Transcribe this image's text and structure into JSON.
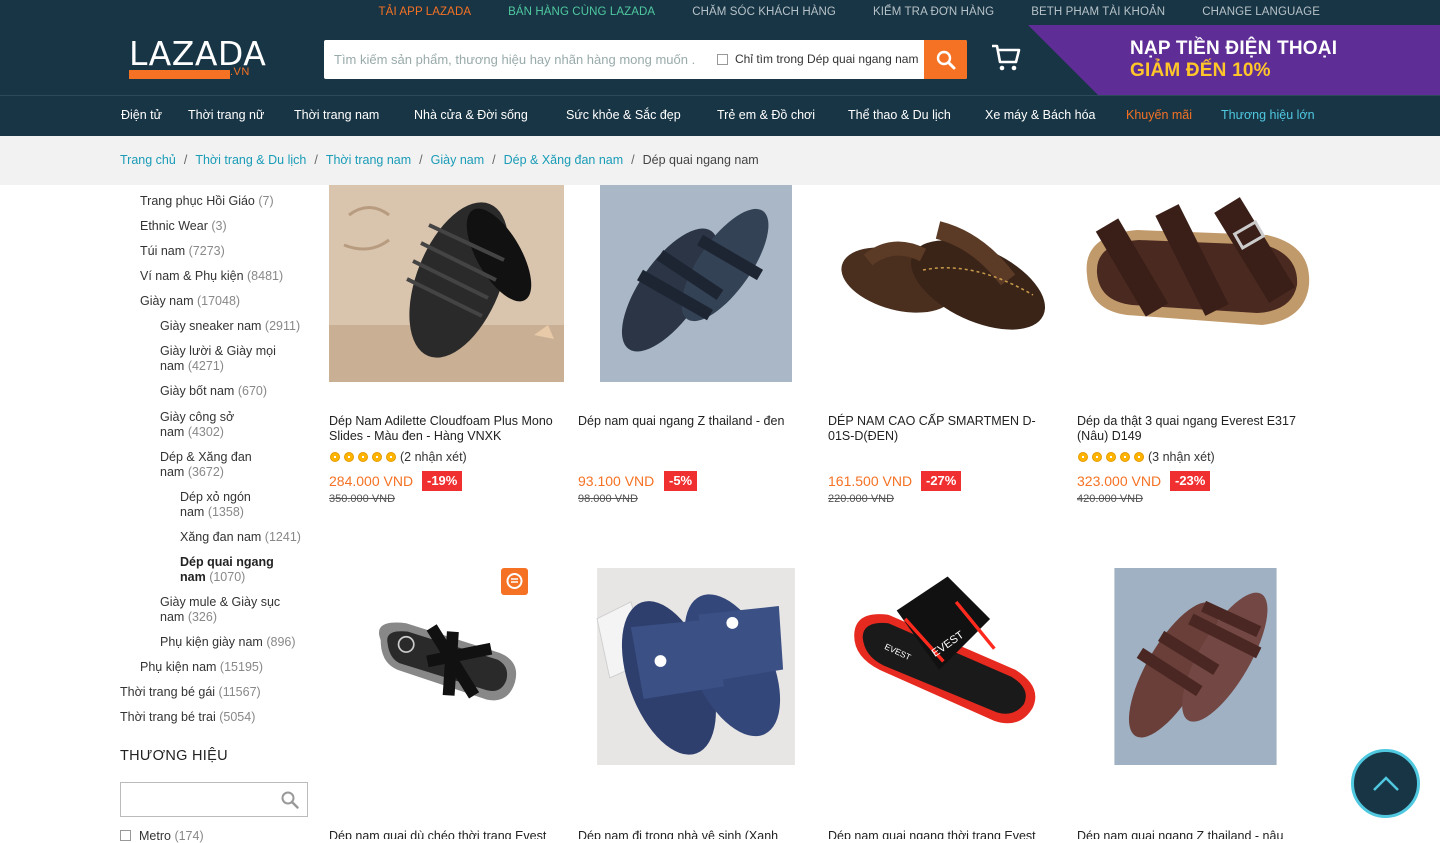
{
  "topbar": {
    "links": [
      {
        "label": "TẢI APP LAZADA",
        "style": "orange"
      },
      {
        "label": "BÁN HÀNG CÙNG LAZADA",
        "style": "green"
      },
      {
        "label": "CHĂM SÓC KHÁCH HÀNG",
        "style": ""
      },
      {
        "label": "KIỂM TRA ĐƠN HÀNG",
        "style": ""
      },
      {
        "label": "BETH PHAM TÀI KHOẢN",
        "style": ""
      },
      {
        "label": "CHANGE LANGUAGE",
        "style": ""
      }
    ]
  },
  "header": {
    "logo_text": "LAZADA",
    "logo_suffix": ".VN",
    "search_placeholder": "Tìm kiếm sản phẩm, thương hiệu hay nhãn hàng mong muốn .",
    "search_only_label": "Chỉ tìm trong Dép quai ngang nam",
    "promo_line1": "NẠP TIỀN ĐIỆN THOẠI",
    "promo_line2": "GIẢM ĐẾN 10%"
  },
  "catnav": [
    {
      "label": "Điện tử",
      "style": ""
    },
    {
      "label": "Thời trang nữ",
      "style": ""
    },
    {
      "label": "Thời trang nam",
      "style": ""
    },
    {
      "label": "Nhà cửa & Đời sống",
      "style": ""
    },
    {
      "label": "Sức khỏe & Sắc đẹp",
      "style": ""
    },
    {
      "label": "Trẻ em & Đồ chơi",
      "style": ""
    },
    {
      "label": "Thể thao & Du lịch",
      "style": ""
    },
    {
      "label": "Xe máy & Bách hóa",
      "style": ""
    },
    {
      "label": "Khuyến mãi",
      "style": "orange"
    },
    {
      "label": "Thương hiệu lớn",
      "style": "teal"
    }
  ],
  "breadcrumb": {
    "items": [
      "Trang chủ",
      "Thời trang & Du lịch",
      "Thời trang nam",
      "Giày nam",
      "Dép & Xăng đan nam"
    ],
    "current": "Dép quai ngang nam"
  },
  "sidebar": {
    "categories": [
      {
        "name": "Trang phục Hồi Giáo",
        "count": "(7)"
      },
      {
        "name": "Ethnic Wear",
        "count": "(3)"
      },
      {
        "name": "Túi nam",
        "count": "(7273)"
      },
      {
        "name": "Ví nam & Phụ kiện",
        "count": "(8481)"
      },
      {
        "name": "Giày nam",
        "count": "(17048)"
      },
      {
        "name": "Giày sneaker nam",
        "count": "(2911)"
      },
      {
        "name": "Giày lười & Giày mọi nam",
        "count": "(4271)"
      },
      {
        "name": "Giày bốt nam",
        "count": "(670)"
      },
      {
        "name": "Giày công sở nam",
        "count": "(4302)"
      },
      {
        "name": "Dép & Xăng đan nam",
        "count": "(3672)"
      },
      {
        "name": "Dép xỏ ngón nam",
        "count": "(1358)"
      },
      {
        "name": "Xăng đan nam",
        "count": "(1241)"
      },
      {
        "name": "Dép quai ngang nam",
        "count": "(1070)"
      },
      {
        "name": "Giày mule & Giày sục nam",
        "count": "(326)"
      },
      {
        "name": "Phụ kiện giày nam",
        "count": "(896)"
      },
      {
        "name": "Phụ kiện nam",
        "count": "(15195)"
      },
      {
        "name": "Thời trang bé gái",
        "count": "(11567)"
      },
      {
        "name": "Thời trang bé trai",
        "count": "(5054)"
      }
    ],
    "brand_title": "THƯƠNG HIỆU",
    "brand_item": {
      "name": "Metro",
      "count": "(174)"
    }
  },
  "products": [
    {
      "title": "Dép Nam Adilette Cloudfoam Plus Mono Slides - Màu đen - Hàng VNXK",
      "reviews": "(2 nhận xét)",
      "price": "284.000 VND",
      "discount": "-19%",
      "old_price": "350.000 VND",
      "image": "black-slide"
    },
    {
      "title": "Dép nam quai ngang Z thailand - đen",
      "reviews": "",
      "price": "93.100 VND",
      "discount": "-5%",
      "old_price": "98.000 VND",
      "image": "navy-sandal"
    },
    {
      "title": "DÉP NAM CAO CẤP SMARTMEN D-01S-D(ĐEN)",
      "reviews": "",
      "price": "161.500 VND",
      "discount": "-27%",
      "old_price": "220.000 VND",
      "image": "brown-flipflop"
    },
    {
      "title": "Dép da thật 3 quai ngang Everest E317 (Nâu) D149",
      "reviews": "(3 nhận xét)",
      "price": "323.000 VND",
      "discount": "-23%",
      "old_price": "420.000 VND",
      "image": "leather-slide"
    },
    {
      "title": "Dép nam quai dù chéo thời trang Evest",
      "image": "black-cross-slide"
    },
    {
      "title": "Dép nam đi trong nhà vệ sinh (Xanh",
      "image": "blue-slide"
    },
    {
      "title": "Dép nam quai ngang thời trang Evest",
      "image": "red-evest-slide"
    },
    {
      "title": "Dép nam quai ngang Z thailand - nâu",
      "image": "brown-sandal"
    }
  ],
  "colors": {
    "dark": "#183545",
    "orange": "#f57224",
    "teal": "#1a9cb7",
    "discount": "#f03030",
    "promo": "#5f2d96"
  }
}
